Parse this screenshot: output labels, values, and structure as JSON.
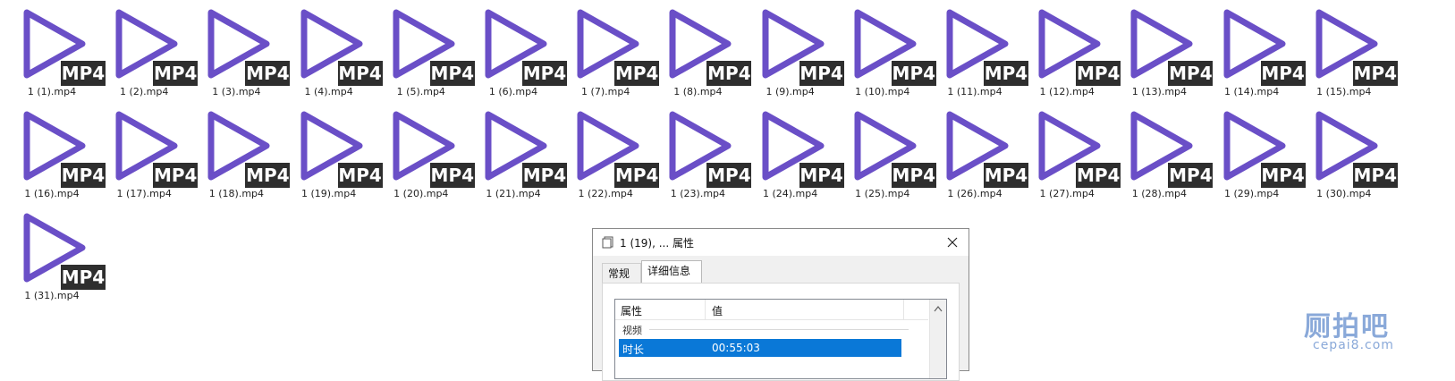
{
  "files": {
    "badge_text": "MP4",
    "icon": "play-triangle-icon",
    "icon_color": "#6a4fc7",
    "items": [
      "1 (1).mp4",
      "1 (2).mp4",
      "1 (3).mp4",
      "1 (4).mp4",
      "1 (5).mp4",
      "1 (6).mp4",
      "1 (7).mp4",
      "1 (8).mp4",
      "1 (9).mp4",
      "1 (10).mp4",
      "1 (11).mp4",
      "1 (12).mp4",
      "1 (13).mp4",
      "1 (14).mp4",
      "1 (15).mp4",
      "1 (16).mp4",
      "1 (17).mp4",
      "1 (18).mp4",
      "1 (19).mp4",
      "1 (20).mp4",
      "1 (21).mp4",
      "1 (22).mp4",
      "1 (23).mp4",
      "1 (24).mp4",
      "1 (25).mp4",
      "1 (26).mp4",
      "1 (27).mp4",
      "1 (28).mp4",
      "1 (29).mp4",
      "1 (30).mp4",
      "1 (31).mp4"
    ]
  },
  "dialog": {
    "title": "1 (19), ... 属性",
    "tabs": [
      "常规",
      "详细信息"
    ],
    "active_tab": "详细信息",
    "columns": [
      "属性",
      "值"
    ],
    "group": "视频",
    "selected_row": {
      "key": "时长",
      "value": "00:55:03"
    },
    "selection_color": "#0a78d7"
  },
  "watermark": {
    "main": "厕拍吧",
    "sub": "cepai8.com"
  }
}
